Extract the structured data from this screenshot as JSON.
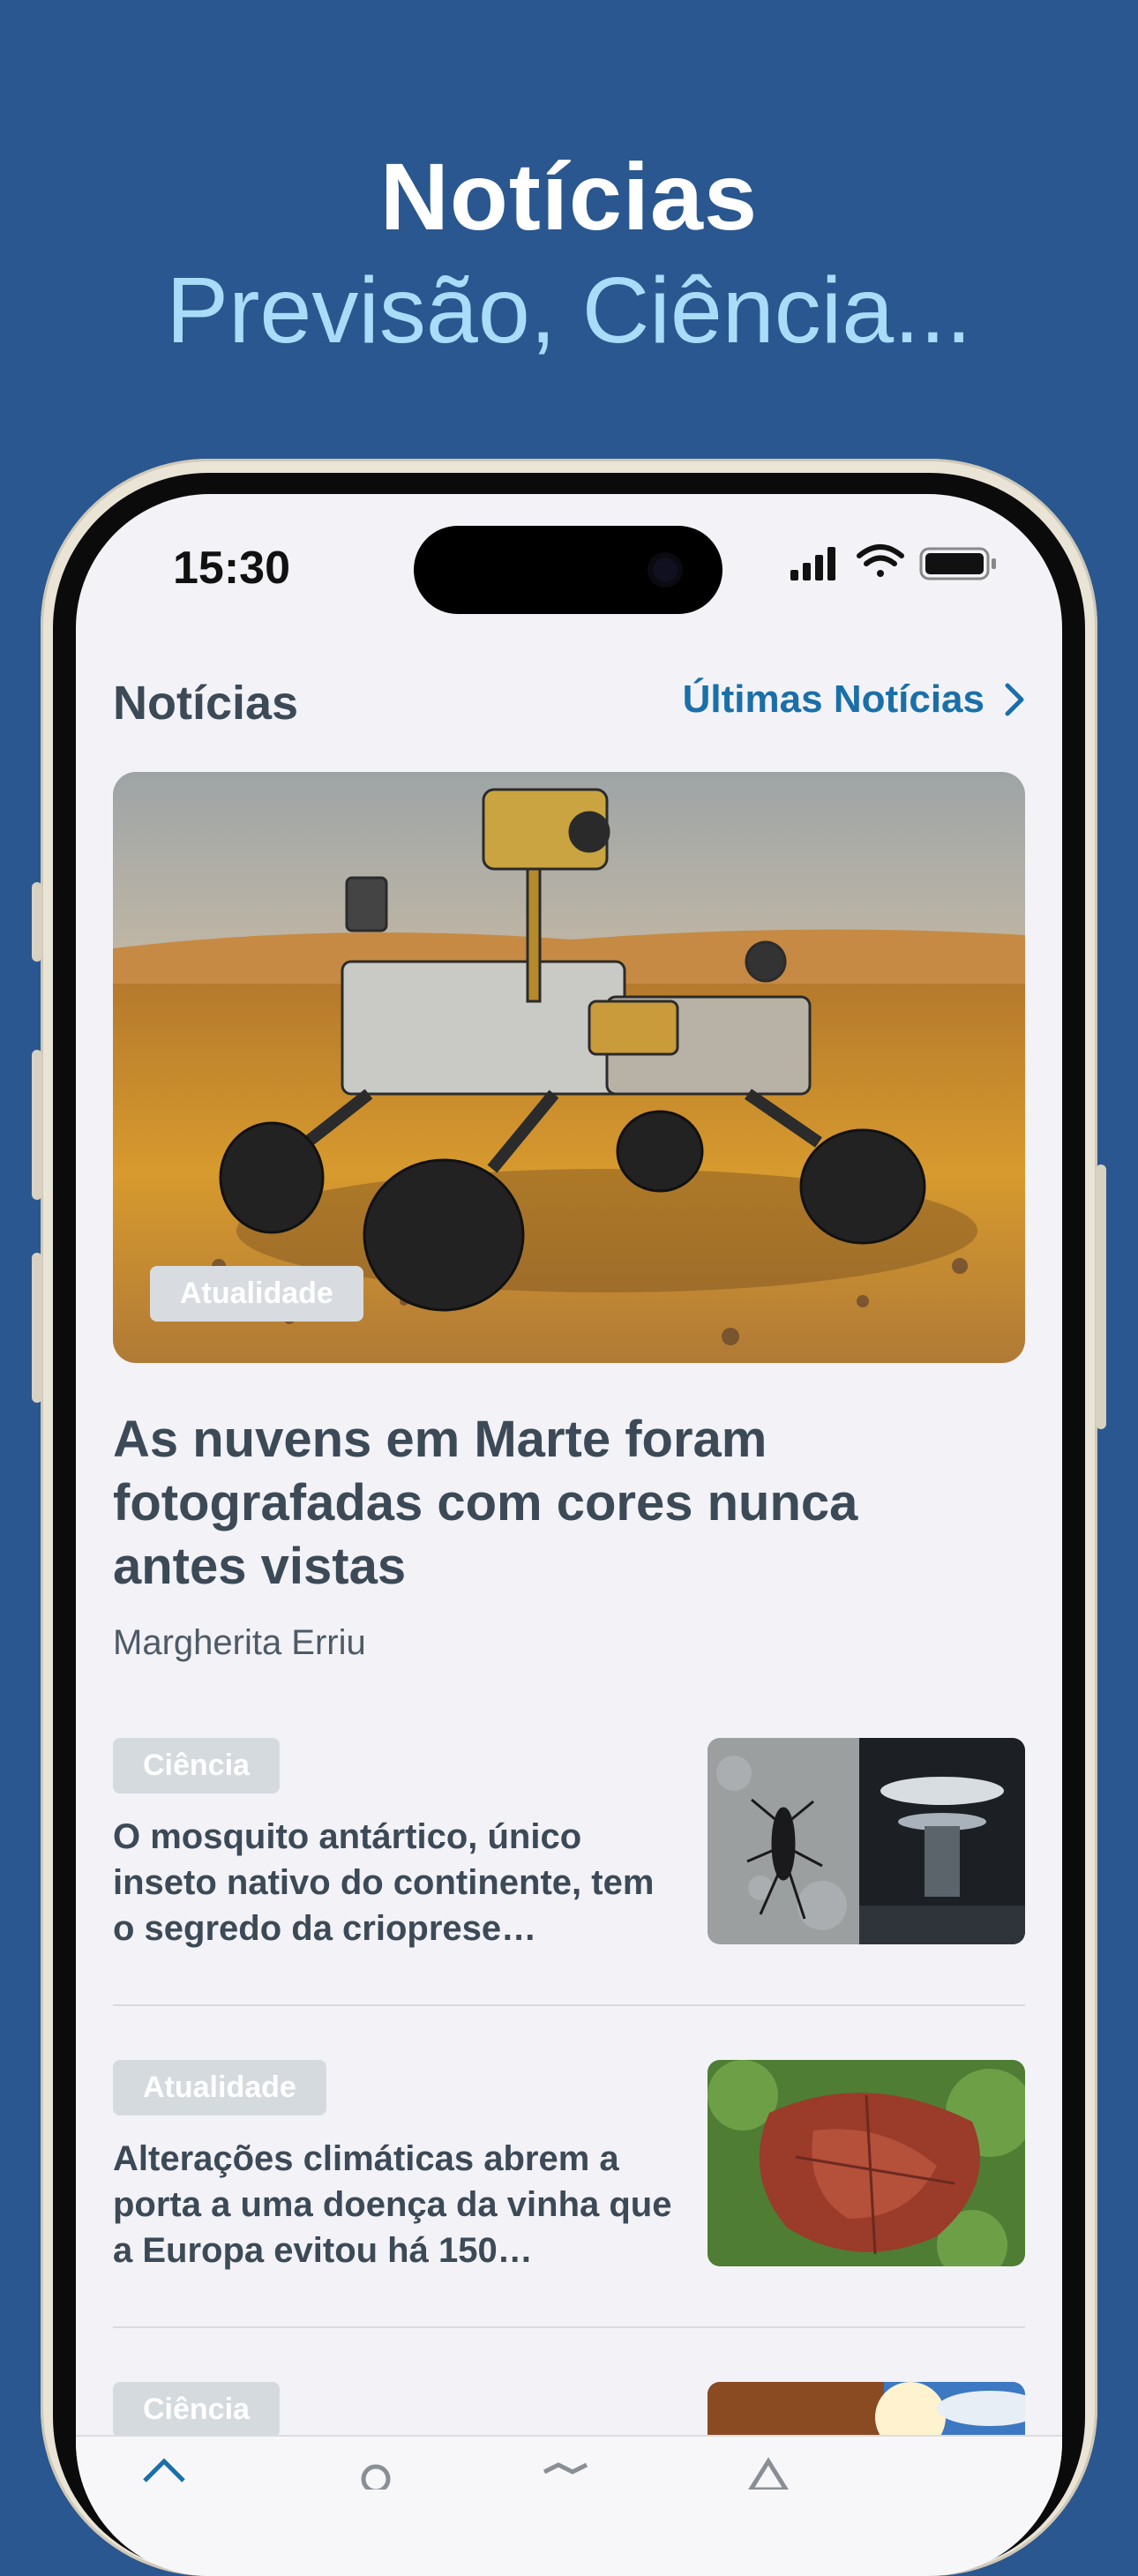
{
  "promo": {
    "title": "Notícias",
    "subtitle": "Previsão, Ciência..."
  },
  "status_bar": {
    "time": "15:30"
  },
  "news": {
    "section_title": "Notícias",
    "latest_link": "Últimas Notícias",
    "hero": {
      "badge": "Atualidade",
      "title": "As nuvens em Marte foram fotografadas com cores nunca antes vistas",
      "author": "Margherita Erriu",
      "image": "mars-rover-photo"
    },
    "items": [
      {
        "badge": "Ciência",
        "title": "O mosquito antártico, único inseto nativo do continente, tem o segredo da crioprese…",
        "image": "mosquito-and-lab-photo"
      },
      {
        "badge": "Atualidade",
        "title": "Alterações climáticas abrem a porta a uma doença da vinha que a Europa evitou há 150…",
        "image": "vine-leaf-photo"
      },
      {
        "badge": "Ciência",
        "title": "",
        "image": "sky-sun-photo"
      }
    ]
  },
  "colors": {
    "background": "#2a578f",
    "subtitle": "#a9dcf8",
    "accent": "#1a6fa8",
    "text": "#3c4a57"
  },
  "icons": {
    "latest_link": "chevron-right-icon",
    "status": [
      "cellular-signal-icon",
      "wifi-icon",
      "battery-icon"
    ],
    "tabs": [
      "home-icon",
      "gear-icon",
      "map-icon",
      "alert-icon"
    ]
  }
}
